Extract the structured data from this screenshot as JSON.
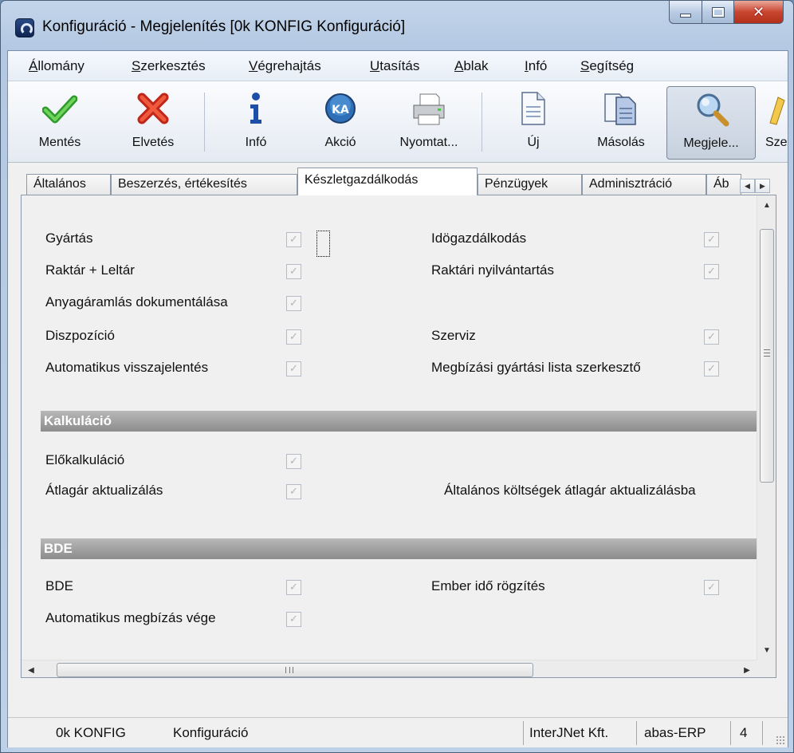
{
  "window": {
    "title": "Konfiguráció - Megjelenítés  [0k  KONFIG  Konfiguráció]"
  },
  "menu": [
    {
      "label": "Állomány",
      "u": "Á",
      "rest": "llomány"
    },
    {
      "label": "Szerkesztés",
      "u": "S",
      "rest": "zerkesztés"
    },
    {
      "label": "Végrehajtás",
      "u": "V",
      "rest": "égrehajtás"
    },
    {
      "label": "Utasítás",
      "u": "U",
      "rest": "tasítás"
    },
    {
      "label": "Ablak",
      "u": "A",
      "rest": "blak"
    },
    {
      "label": "Infó",
      "u": "I",
      "rest": "nfó"
    },
    {
      "label": "Segítség",
      "u": "S",
      "rest": "egítség"
    }
  ],
  "toolbar": {
    "save": "Mentés",
    "discard": "Elvetés",
    "info": "Infó",
    "action": "Akció",
    "print": "Nyomtat...",
    "new": "Új",
    "copy": "Másolás",
    "display": "Megjele...",
    "edit": "Szer"
  },
  "tabs": [
    "Általános",
    "Beszerzés, értékesítés",
    "Készletgazdálkodás",
    "Pénzügyek",
    "Adminisztráció",
    "Áb"
  ],
  "selected_tab": "Készletgazdálkodás",
  "options": {
    "production": "Gyártás",
    "time_management": "Idögazdálkodás",
    "warehouse_inventory": "Raktár + Leltár",
    "warehouse_records": "Raktári nyilvántartás",
    "material_flow": "Anyagáramlás dokumentálása",
    "disposition": "Diszpozíció",
    "service": "Szerviz",
    "auto_feedback": "Automatikus visszajelentés",
    "order_list_editor": "Megbízási gyártási lista szerkesztő"
  },
  "sections": {
    "calculation": "Kalkuláció",
    "bde": "BDE"
  },
  "calc_options": {
    "precalc": "Előkalkuláció",
    "avg_price": "Átlagár aktualizálás",
    "general_costs": "Általános költségek átlagár aktualizálásba"
  },
  "bde_options": {
    "bde": "BDE",
    "human_time": "Ember idő rögzítés",
    "auto_order_end": "Automatikus megbízás vége"
  },
  "checkbox_state": "checked-disabled",
  "status": {
    "client": "0k KONFIG",
    "module": "Konfiguráció",
    "company": "InterJNet Kft.",
    "product": "abas-ERP",
    "number": "4"
  },
  "icons": {
    "save": "check-icon",
    "discard": "x-icon",
    "info": "info-icon",
    "action": "action-icon",
    "print": "printer-icon",
    "new": "document-icon",
    "copy": "copy-icon",
    "display": "magnifier-icon"
  }
}
